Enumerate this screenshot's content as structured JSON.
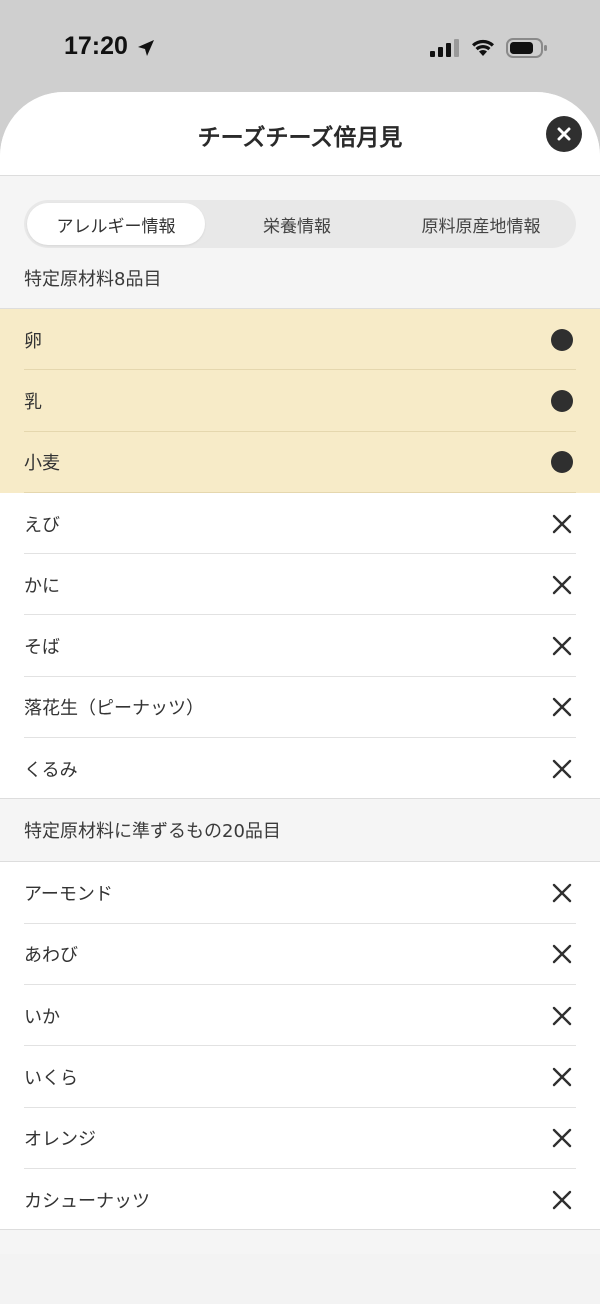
{
  "status": {
    "time": "17:20"
  },
  "header": {
    "title": "チーズチーズ倍月見"
  },
  "tabs": [
    {
      "label": "アレルギー情報",
      "active": true
    },
    {
      "label": "栄養情報",
      "active": false
    },
    {
      "label": "原料原産地情報",
      "active": false
    }
  ],
  "section1": {
    "title": "特定原材料8品目",
    "items": [
      {
        "name": "卵",
        "contains": true
      },
      {
        "name": "乳",
        "contains": true
      },
      {
        "name": "小麦",
        "contains": true
      },
      {
        "name": "えび",
        "contains": false
      },
      {
        "name": "かに",
        "contains": false
      },
      {
        "name": "そば",
        "contains": false
      },
      {
        "name": "落花生（ピーナッツ）",
        "contains": false
      },
      {
        "name": "くるみ",
        "contains": false
      }
    ]
  },
  "section2": {
    "title": "特定原材料に準ずるもの20品目",
    "items": [
      {
        "name": "アーモンド",
        "contains": false
      },
      {
        "name": "あわび",
        "contains": false
      },
      {
        "name": "いか",
        "contains": false
      },
      {
        "name": "いくら",
        "contains": false
      },
      {
        "name": "オレンジ",
        "contains": false
      },
      {
        "name": "カシューナッツ",
        "contains": false
      }
    ]
  },
  "colors": {
    "highlight": "#f7ebc8",
    "mark": "#2f2f2f"
  }
}
